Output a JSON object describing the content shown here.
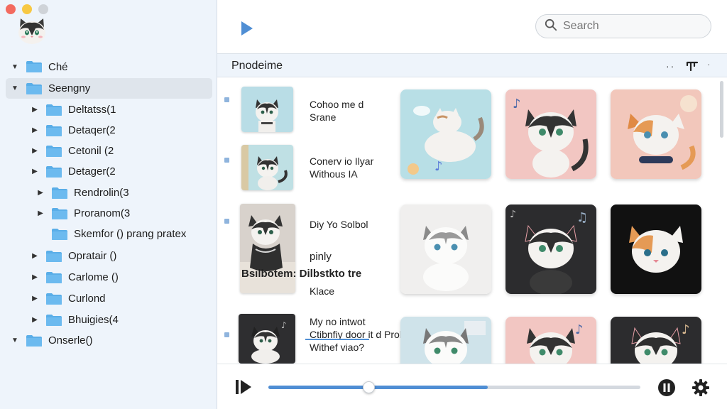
{
  "sidebar": {
    "tree": [
      {
        "label": "Ché",
        "level": 0,
        "expanded": true,
        "icon": "folder-icon"
      },
      {
        "label": "Seengny",
        "level": 0,
        "expanded": true,
        "selected": true,
        "icon": "folder-icon"
      },
      {
        "label": "Deltatss(1",
        "level": 1,
        "expanded": false,
        "icon": "folder-icon"
      },
      {
        "label": "Detaqer(2",
        "level": 1,
        "expanded": false,
        "icon": "folder-icon"
      },
      {
        "label": "Cetonil (2",
        "level": 1,
        "expanded": false,
        "icon": "folder-icon"
      },
      {
        "label": "Detager(2",
        "level": 1,
        "expanded": false,
        "icon": "folder-icon"
      },
      {
        "label": "Rendrolin(3",
        "level": 2,
        "expanded": false,
        "icon": "folder-icon"
      },
      {
        "label": "Proranom(3",
        "level": 2,
        "expanded": false,
        "icon": "folder-icon"
      },
      {
        "label": "Skemfor () prang pratex",
        "level": 2,
        "expanded": null,
        "icon": "folder-icon"
      },
      {
        "label": "Opratair ()",
        "level": 1,
        "expanded": false,
        "icon": "folder-icon"
      },
      {
        "label": "Carlome ()",
        "level": 1,
        "expanded": false,
        "icon": "folder-icon"
      },
      {
        "label": "Curlond",
        "level": 1,
        "expanded": false,
        "icon": "folder-icon"
      },
      {
        "label": "Bhuigies(4",
        "level": 1,
        "expanded": false,
        "icon": "folder-icon"
      },
      {
        "label": "Onserle()",
        "level": 0,
        "expanded": true,
        "icon": "folder-icon"
      }
    ]
  },
  "search": {
    "placeholder": "Search"
  },
  "section": {
    "title": "Pnodeime"
  },
  "rows": [
    {
      "lines": [
        "Cohoo me d",
        "Srane"
      ]
    },
    {
      "lines": [
        "Conerv io Ilyar",
        "Withous      IA"
      ]
    },
    {
      "lines": [
        "Diy Yo Solbol",
        "pinly",
        "Bsilbotem: Dilbstkto tre",
        "Klace"
      ]
    },
    {
      "lines": [
        "My no intwot",
        "Ctibnfiy door it d Probor",
        "Withef viao?"
      ]
    }
  ],
  "player": {
    "progress_percent": 59,
    "knob_percent": 27
  },
  "colors": {
    "accent": "#4f8ed4",
    "folder": "#5aaee8",
    "sidebar_bg": "#eef4fb"
  }
}
